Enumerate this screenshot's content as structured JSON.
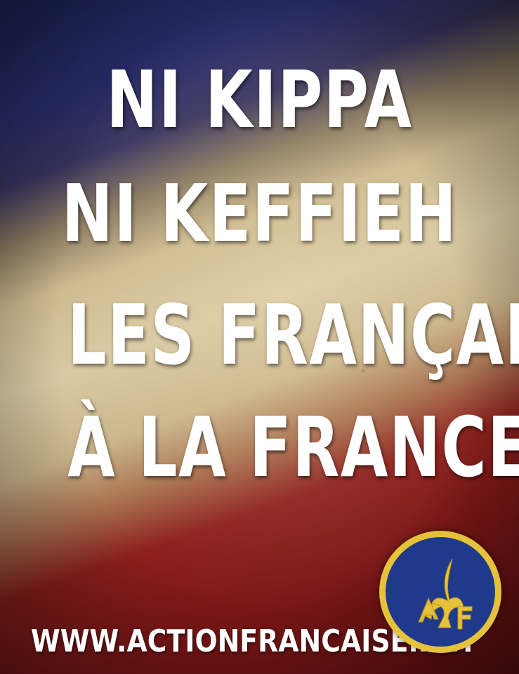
{
  "headline": {
    "line1": "NI KIPPA",
    "line2": "NI KEFFIEH",
    "line3": "LES FRANÇAIS",
    "line4": "À LA FRANCE !"
  },
  "footer": {
    "url": "WWW.ACTIONFRANCAISE.NET"
  },
  "logo": {
    "letters": "AF",
    "icon": "fleur-de-lis-icon",
    "ring_color": "#e6c23a",
    "disc_color": "#1f3a8a"
  },
  "colors": {
    "blue": "#2b2f70",
    "white": "#d9c9a3",
    "red": "#8d1f1c",
    "text": "#ffffff"
  }
}
